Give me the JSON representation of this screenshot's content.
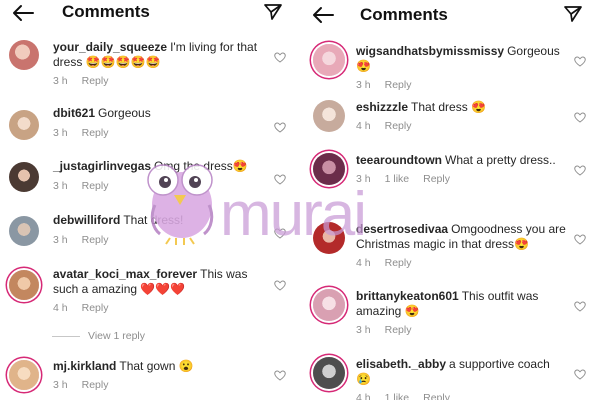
{
  "left": {
    "title": "Comments",
    "comments": [
      {
        "user": "your_daily_squeeze",
        "text": "I'm living for that dress 🤩🤩🤩🤩🤩",
        "time": "3 h",
        "reply": "Reply",
        "likes": "",
        "avatar_color": "#c9746e"
      },
      {
        "user": "dbit621",
        "text": "Gorgeous",
        "time": "3 h",
        "reply": "Reply",
        "likes": "",
        "avatar_color": "#d8b9a0"
      },
      {
        "user": "_justagirlinvegas",
        "text": "Omg the dress😍",
        "time": "3 h",
        "reply": "Reply",
        "likes": "",
        "avatar_color": "#7a5d4f"
      },
      {
        "user": "debwilliford",
        "text": "That dress!",
        "time": "3 h",
        "reply": "Reply",
        "likes": "",
        "avatar_color": "#9aa3ab"
      },
      {
        "user": "avatar_koci_max_forever",
        "text": "This was such a amazing ❤️❤️❤️",
        "time": "4 h",
        "reply": "Reply",
        "likes": "",
        "avatar_color": "#c3875f"
      },
      {
        "user": "mj.kirkland",
        "text": "That gown 😮",
        "time": "3 h",
        "reply": "Reply",
        "likes": "",
        "avatar_color": "#e0b48a"
      }
    ],
    "view_replies": "View 1 reply"
  },
  "right": {
    "title": "Comments",
    "comments": [
      {
        "user": "wigsandhatsbymissmissy",
        "text": "Gorgeous 😍",
        "time": "3 h",
        "reply": "Reply",
        "likes": "",
        "avatar_color": "#e8a9b8"
      },
      {
        "user": "eshizzzle",
        "text": "That dress 😍",
        "time": "4 h",
        "reply": "Reply",
        "likes": "",
        "avatar_color": "#e6d2c7"
      },
      {
        "user": "teearoundtown",
        "text": "What a pretty dress..",
        "time": "3 h",
        "reply": "Reply",
        "likes": "1 like",
        "avatar_color": "#6b2d4a"
      },
      {
        "user": "desertrosedivaa",
        "text": "Omgoodness you are Christmas magic in that dress😍",
        "time": "4 h",
        "reply": "Reply",
        "likes": "",
        "avatar_color": "#b32a2a"
      },
      {
        "user": "brittanykeaton601",
        "text": "This outfit was amazing 😍",
        "time": "3 h",
        "reply": "Reply",
        "likes": "",
        "avatar_color": "#d9a0b2"
      },
      {
        "user": "elisabeth._abby",
        "text": "a supportive coach 😢",
        "time": "4 h",
        "reply": "Reply",
        "likes": "1 like",
        "avatar_color": "#4e4e4e"
      }
    ]
  },
  "watermark": {
    "text": "murai",
    "color": "#c99ad6"
  }
}
